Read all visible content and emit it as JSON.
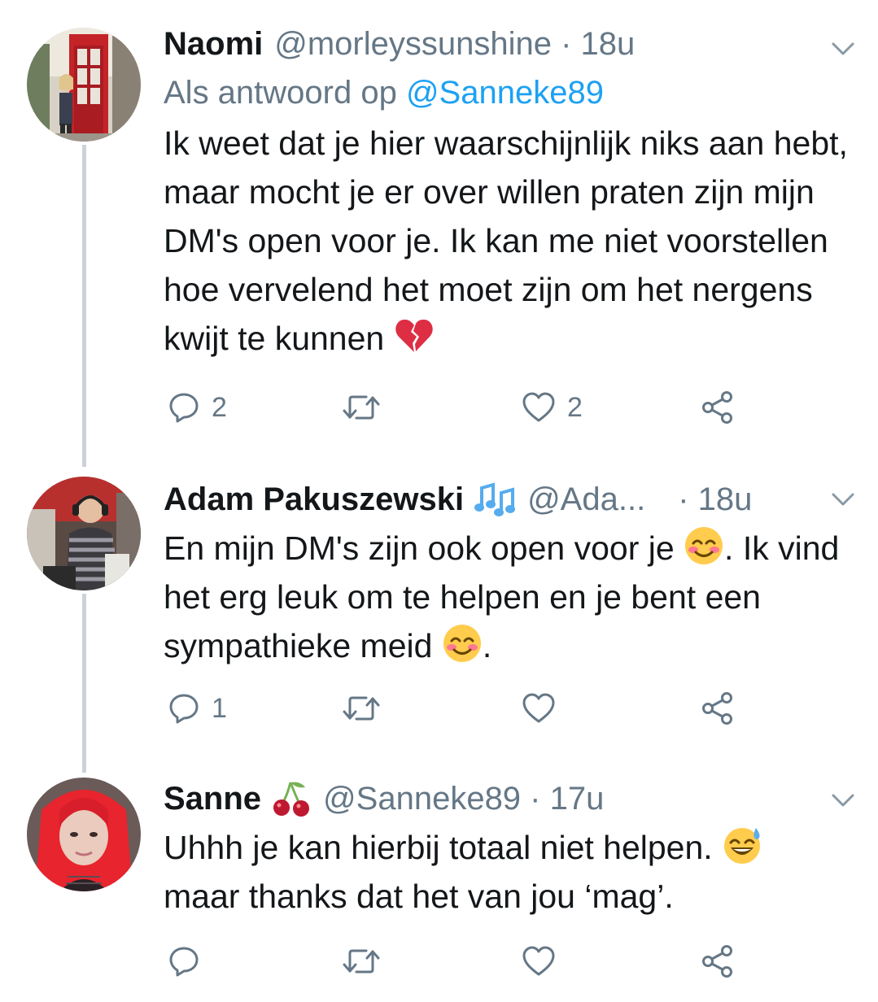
{
  "tweets": [
    {
      "name": "Naomi",
      "handle_time": "@morleyssunshine · 18u",
      "reply_prefix": "Als antwoord op ",
      "reply_link": "@Sanneke89",
      "text_before_emoji": "Ik weet dat je hier waarschijnlijk niks aan hebt, maar mocht je er over willen praten zijn mijn DM's open voor je. Ik kan me niet voorstellen hoe vervelend het moet zijn om het nergens kwijt te kunnen",
      "emoji": "broken-heart",
      "reply_count": "2",
      "retweet_count": "",
      "like_count": "2"
    },
    {
      "name": "Adam Pakuszewski",
      "badge": "musical-notes",
      "handle": "@Ada...",
      "time": "· 18u",
      "text_a": "En mijn DM's zijn ook open voor je ",
      "text_b": ". Ik vind het erg leuk om te helpen en je bent een sympathieke meid ",
      "text_c": ".",
      "emoji": "smiling-face-with-smiling-eyes",
      "reply_count": "1",
      "retweet_count": "",
      "like_count": ""
    },
    {
      "name": "Sanne",
      "badge": "cherries",
      "handle_time": "@Sanneke89 · 17u",
      "text_a": "Uhhh je kan hierbij totaal niet helpen. ",
      "text_b": "maar thanks dat het van jou ‘mag’.",
      "emoji": "grinning-face-with-sweat",
      "reply_count": "",
      "retweet_count": "",
      "like_count": ""
    }
  ],
  "colors": {
    "text": "#14171a",
    "secondary": "#657786",
    "link": "#1da1f2",
    "thread_line": "#cbd3da"
  }
}
